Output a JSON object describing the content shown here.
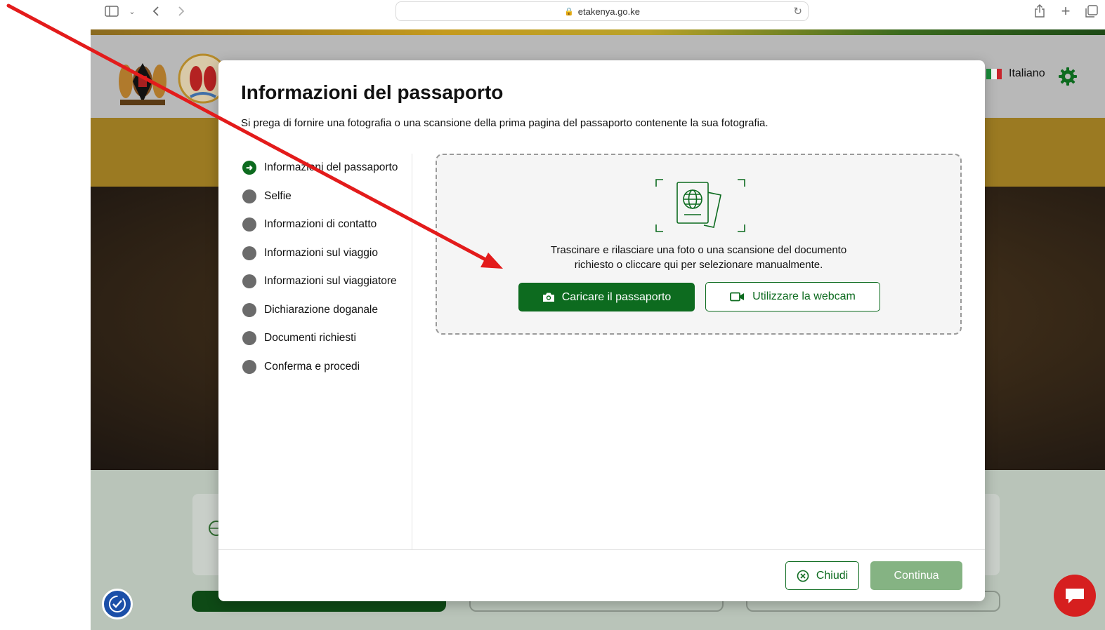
{
  "browser": {
    "url": "etakenya.go.ke"
  },
  "header": {
    "language": "Italiano"
  },
  "modal": {
    "title": "Informazioni del passaporto",
    "subtitle": "Si prega di fornire una fotografia o una scansione della prima pagina del passaporto contenente la sua fotografia.",
    "steps": [
      {
        "label": "Informazioni del passaporto",
        "state": "active"
      },
      {
        "label": "Selfie",
        "state": "pending"
      },
      {
        "label": "Informazioni di contatto",
        "state": "pending"
      },
      {
        "label": "Informazioni sul viaggio",
        "state": "pending"
      },
      {
        "label": "Informazioni sul viaggiatore",
        "state": "pending"
      },
      {
        "label": "Dichiarazione doganale",
        "state": "pending"
      },
      {
        "label": "Documenti richiesti",
        "state": "pending"
      },
      {
        "label": "Conferma e procedi",
        "state": "pending"
      }
    ],
    "dropzone": {
      "line1": "Trascinare e rilasciare una foto o una scansione del documento",
      "line2": "richiesto o cliccare qui per selezionare manualmente.",
      "upload_label": "Caricare il passaporto",
      "webcam_label": "Utilizzare la webcam"
    },
    "footer": {
      "close_label": "Chiudi",
      "continue_label": "Continua"
    }
  },
  "colors": {
    "primary_green": "#0d6b1f",
    "disabled_green": "#85b383",
    "annotation_red": "#e31b1b"
  }
}
